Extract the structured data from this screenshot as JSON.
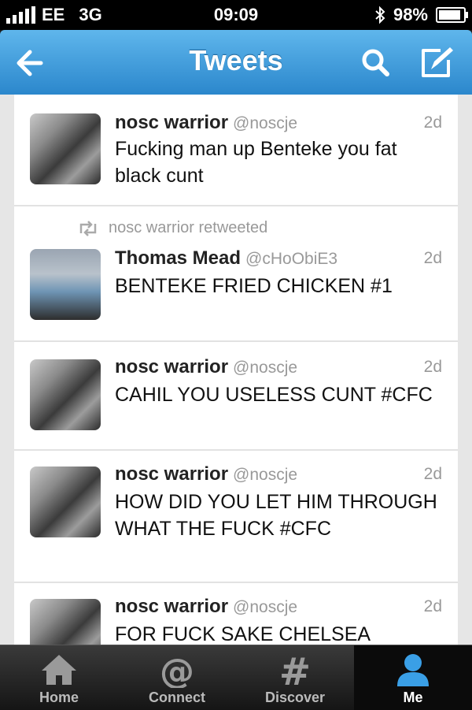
{
  "status": {
    "carrier": "EE",
    "network": "3G",
    "time": "09:09",
    "battery": "98%",
    "battery_level": 0.98
  },
  "nav": {
    "title": "Tweets",
    "icons": [
      "back-arrow-icon",
      "search-icon",
      "compose-icon"
    ]
  },
  "tweets": [
    {
      "name": "nosc warrior",
      "handle": "@noscje",
      "time": "2d",
      "text": "Fucking man up Benteke you fat black cunt"
    },
    {
      "retweet_label": "nosc warrior retweeted",
      "name": "Thomas Mead",
      "handle": "@cHoObiE3",
      "time": "2d",
      "text": "BENTEKE FRIED CHICKEN #1"
    },
    {
      "name": "nosc warrior",
      "handle": "@noscje",
      "time": "2d",
      "text": "CAHIL YOU USELESS CUNT #CFC"
    },
    {
      "name": "nosc warrior",
      "handle": "@noscje",
      "time": "2d",
      "text": "HOW DID YOU LET HIM THROUGH WHAT THE FUCK #CFC"
    },
    {
      "name": "nosc warrior",
      "handle": "@noscje",
      "time": "2d",
      "text": "FOR FUCK SAKE CHELSEA"
    }
  ],
  "tabs": [
    {
      "label": "Home",
      "icon": "home-icon"
    },
    {
      "label": "Connect",
      "icon": "at-icon"
    },
    {
      "label": "Discover",
      "icon": "hash-icon"
    },
    {
      "label": "Me",
      "icon": "person-icon",
      "active": true
    }
  ],
  "colors": {
    "nav_blue": "#2b87cc",
    "tab_active": "#0b0b0b",
    "handle_gray": "#999999"
  }
}
